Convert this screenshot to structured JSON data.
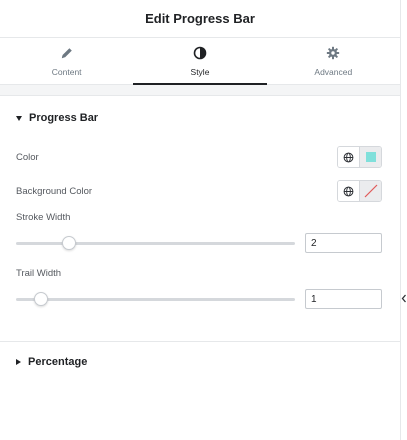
{
  "header": {
    "title": "Edit Progress Bar"
  },
  "tabs": [
    {
      "label": "Content",
      "icon": "pencil-icon",
      "active": false
    },
    {
      "label": "Style",
      "icon": "contrast-icon",
      "active": true
    },
    {
      "label": "Advanced",
      "icon": "gear-icon",
      "active": false
    }
  ],
  "sections": {
    "progress_bar": {
      "title": "Progress Bar",
      "color": {
        "label": "Color",
        "value": "#80e0db"
      },
      "background_color": {
        "label": "Background Color",
        "value": "none"
      },
      "stroke_width": {
        "label": "Stroke Width",
        "value": "2",
        "slider_fraction": 0.19
      },
      "trail_width": {
        "label": "Trail Width",
        "value": "1",
        "slider_fraction": 0.09
      }
    },
    "percentage": {
      "title": "Percentage"
    }
  },
  "colors": {
    "accent": "#1f2124",
    "swatch_teal": "#80e0db",
    "no_color_line": "#e05a5a"
  }
}
